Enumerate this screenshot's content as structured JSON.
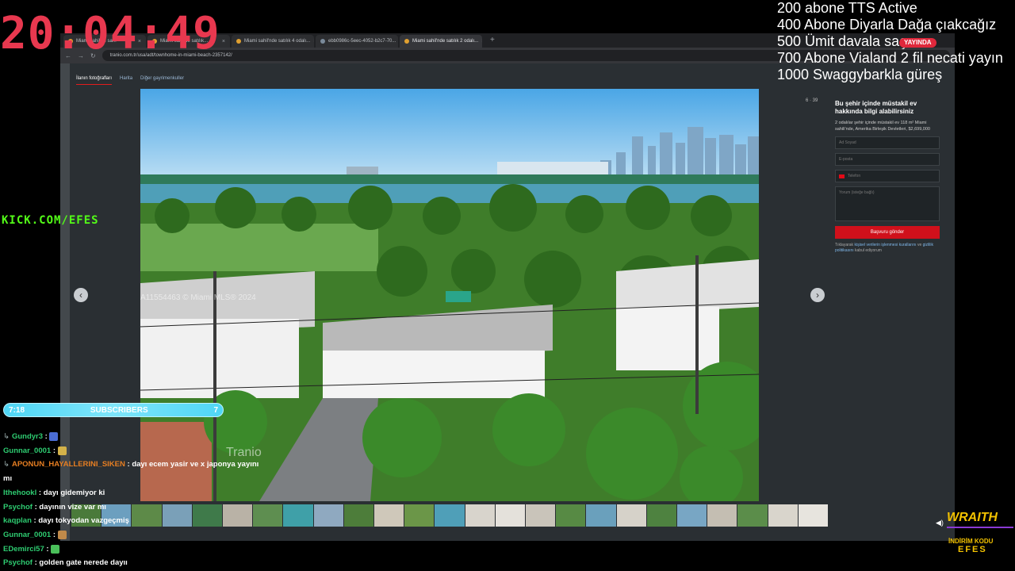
{
  "overlay": {
    "clock": "20:04:49",
    "goals": [
      "200 abone TTS Active",
      "400 Abone Diyarla Dağa çıakcağız",
      "500 Ümit davala saçı",
      "700 Abone Vialand 2 fil necati yayın",
      "1000 Swaggybarkla güreş"
    ],
    "live_badge": "YAYINDA",
    "kick_url": "KICK.COM/EFES",
    "subscribers": {
      "left": "7:18",
      "label": "SUBSCRIBERS",
      "count": "7",
      "progress": 1.0
    },
    "sponsor": {
      "brand": "WRAITH",
      "code_label": "İNDİRİM KODU",
      "code": "EFES"
    }
  },
  "browser": {
    "tabs": [
      {
        "title": "Miami sahil'de sa..."
      },
      {
        "title": "Miami sahil'de satılık..."
      },
      {
        "title": "Miami sahil'nde satılık 4 odalı..."
      },
      {
        "title": "ebb0986c-5eec-4052-b2c7-70..."
      },
      {
        "title": "Miami sahil'nde satılık 2 odalı..."
      }
    ],
    "url": "tranio.com.tr/usa/adt/townhome-in-miami-beach-2357142/"
  },
  "page": {
    "tabs": [
      "İlanın fotoğrafları",
      "Harita",
      "Diğer gayrimenkuller"
    ],
    "counter": "6 · 39",
    "watermark": "A11554463 © Miami MLS® 2024",
    "photo_watermark": "Tranio",
    "form": {
      "title": "Bu şehir içinde müstakil ev hakkında bilgi alabilirsiniz",
      "desc": "2 odalılar şehir içinde müstakil ev 118 m² Miami sahili'nde, Amerika Birleşik Devletleri, $2,699,000",
      "name_placeholder": "Ad Soyad",
      "email_placeholder": "E-posta",
      "phone_placeholder": "Telefon",
      "message_placeholder": "Yorum (isteğe bağlı)",
      "submit": "Başvuru gönder",
      "consent_pre": "Tıklayarak",
      "consent_link1": "kişisel verilerin işlenmesi kurallarını",
      "consent_mid": "ve",
      "consent_link2": "gizlilik politikasını",
      "consent_post": "kabul ediyorum"
    }
  },
  "chat": [
    {
      "user": "Gundyr3",
      "text": "",
      "color": "#2ecc71",
      "badge": true,
      "emote": "#4a6cd4"
    },
    {
      "user": "Gunnar_0001",
      "text": "",
      "color": "#2ecc71",
      "badge": false,
      "emote": "#d4b24a"
    },
    {
      "user": "APONUN_HAYALLERINI_SIKEN",
      "text": "dayı ecem yasir ve x japonya yayını",
      "color": "#e67e22",
      "badge": true,
      "emote": ""
    },
    {
      "user": "",
      "text": "mı",
      "color": "#fff",
      "badge": false,
      "emote": ""
    },
    {
      "user": "Ithehookl",
      "text": "dayı gidemiyor ki",
      "color": "#2ecc71",
      "badge": false,
      "emote": ""
    },
    {
      "user": "Psychof",
      "text": "dayının vize var mı",
      "color": "#2ecc71",
      "badge": false,
      "emote": ""
    },
    {
      "user": "kaqplan",
      "text": "dayı tokyodan vazgeçmiş",
      "color": "#2ecc71",
      "badge": false,
      "emote": ""
    },
    {
      "user": "Gunnar_0001",
      "text": "",
      "color": "#2ecc71",
      "badge": false,
      "emote": "#c08a4a"
    },
    {
      "user": "EDemirci57",
      "text": "",
      "color": "#2ecc71",
      "badge": false,
      "emote": "#4ac05a"
    },
    {
      "user": "Psychof",
      "text": "golden gate nerede dayıı",
      "color": "#2ecc71",
      "badge": false,
      "emote": ""
    }
  ]
}
